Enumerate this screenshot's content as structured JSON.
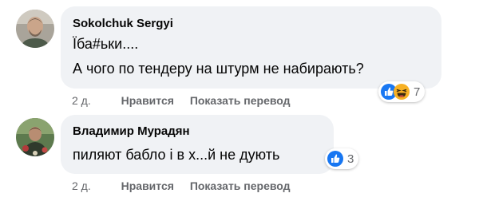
{
  "comments": [
    {
      "author": "Sokolchuk Sergyi",
      "lines": [
        "Їба#ьки....",
        "А чого по тендеру на штурм не набирають?"
      ],
      "reactions": {
        "icons": [
          "like-icon",
          "haha-icon"
        ],
        "count": "7"
      },
      "timestamp": "2 д.",
      "like_label": "Нравится",
      "translate_label": "Показать перевод"
    },
    {
      "author": "Владимир Мурадян",
      "lines": [
        "пиляют бабло і в х...й не дують"
      ],
      "reactions": {
        "icons": [
          "like-icon"
        ],
        "count": "3"
      },
      "timestamp": "2 д.",
      "like_label": "Нравится",
      "translate_label": "Показать перевод"
    }
  ],
  "colors": {
    "bubble": "#f0f2f5",
    "meta_text": "#65676b",
    "like_blue": "#1877f2",
    "haha_yellow": "#f7b125"
  }
}
